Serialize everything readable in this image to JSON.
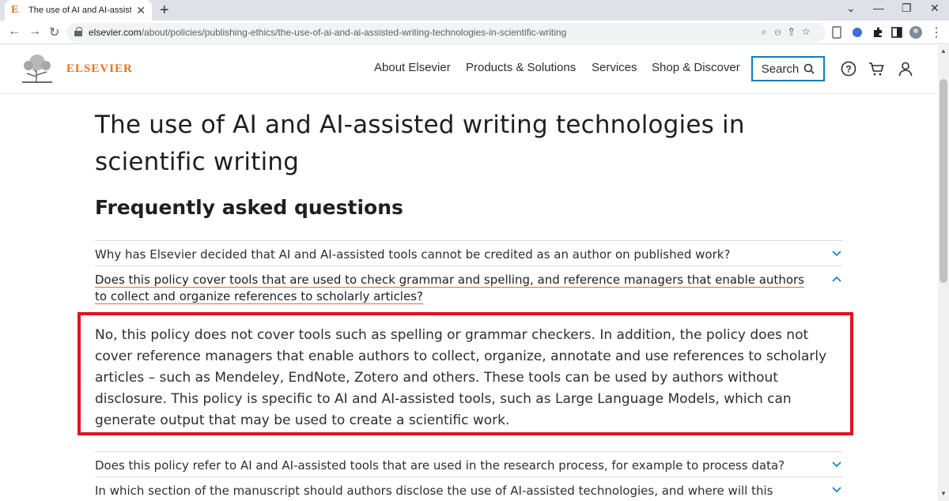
{
  "browser": {
    "tab_title": "The use of AI and AI-assisted wri",
    "tab_favicon": "E",
    "url_domain": "elsevier.com",
    "url_path": "/about/policies/publishing-ethics/the-use-of-ai-and-ai-assisted-writing-technologies-in-scientific-writing"
  },
  "header": {
    "logo_text": "ELSEVIER",
    "nav": [
      "About Elsevier",
      "Products & Solutions",
      "Services",
      "Shop & Discover"
    ],
    "search_label": "Search"
  },
  "main": {
    "title": "The use of AI and AI-assisted writing technologies in scientific writing",
    "faq_heading": "Frequently asked questions",
    "faq": [
      {
        "question": "Why has Elsevier decided that AI and AI-assisted tools cannot be credited as an author on published work?"
      },
      {
        "question": "Does this policy cover tools that are used to check grammar and spelling, and reference managers that enable authors to collect and organize references to scholarly articles?"
      },
      {
        "question": "Does this policy refer to AI and AI-assisted tools that are used in the research process, for example to process data?"
      },
      {
        "question": "In which section of the manuscript should authors disclose the use of AI-assisted technologies, and where will this statement appear in the article"
      }
    ],
    "answer": "No, this policy does not cover tools such as spelling or grammar checkers. In addition, the policy does not cover reference managers that enable authors to collect, organize, annotate and use references to scholarly articles – such as Mendeley, EndNote, Zotero and others. These tools can be used by authors without disclosure. This policy is specific to AI and AI-assisted tools, such as Large Language Models, which can generate output that may be used to create a scientific work."
  },
  "colors": {
    "brand_orange": "#e9711c",
    "accent_blue": "#0c7dbb",
    "highlight_red": "#e0141e"
  }
}
